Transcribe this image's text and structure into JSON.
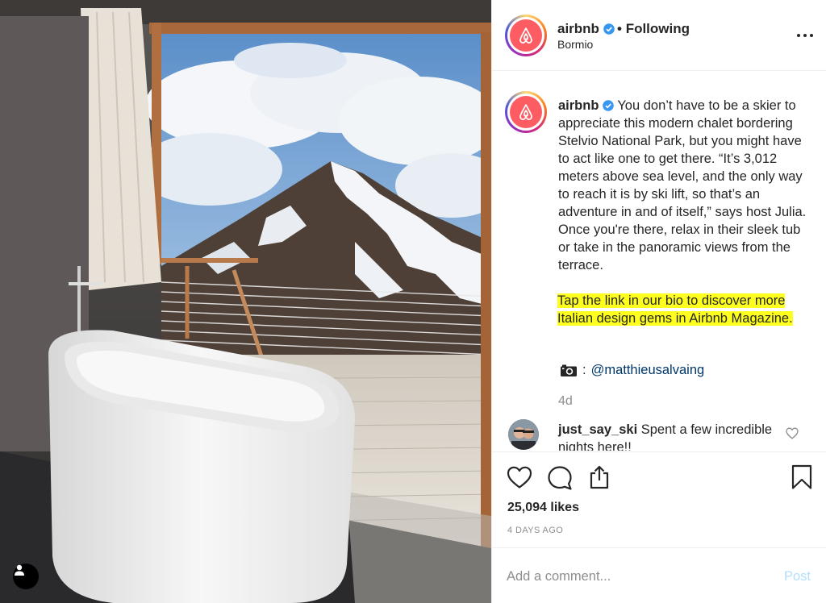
{
  "header": {
    "username": "airbnb",
    "separator": "•",
    "follow_status": "Following",
    "location": "Bormio"
  },
  "caption": {
    "username": "airbnb",
    "text": "You don’t have to be a skier to appreciate this modern chalet bordering Stelvio National Park, but you might have to act like one to get there. “It’s 3,012 meters above sea level, and the only way to reach it is by ski lift, so that’s an adventure in and of itself,” says host Julia. Once you're there, relax in their sleek tub or take in the panoramic views from the terrace.",
    "highlighted_text": "Tap the link in our bio to discover more Italian design gems in Airbnb Magazine.",
    "credit_prefix": ":",
    "credit_mention": "@matthieusalvaing",
    "age": "4d"
  },
  "comments": [
    {
      "username": "just_say_ski",
      "text": "Spent a few incredible nights here!!"
    }
  ],
  "stats": {
    "likes": "25,094 likes",
    "time_ago": "4 DAYS AGO"
  },
  "add_comment": {
    "placeholder": "Add a comment...",
    "post_label": "Post"
  },
  "colors": {
    "brand": "#fd5c63",
    "verified": "#3897f0",
    "highlight": "#ffff1f",
    "mention": "#00376b",
    "muted": "#8e8e8e",
    "post_disabled": "#b2dffc"
  },
  "icons": {
    "more": "more-options-icon",
    "like": "heart-icon",
    "comment": "comment-bubble-icon",
    "share": "share-icon",
    "save": "bookmark-icon",
    "camera": "camera-icon",
    "user_tag": "user-tag-icon"
  }
}
